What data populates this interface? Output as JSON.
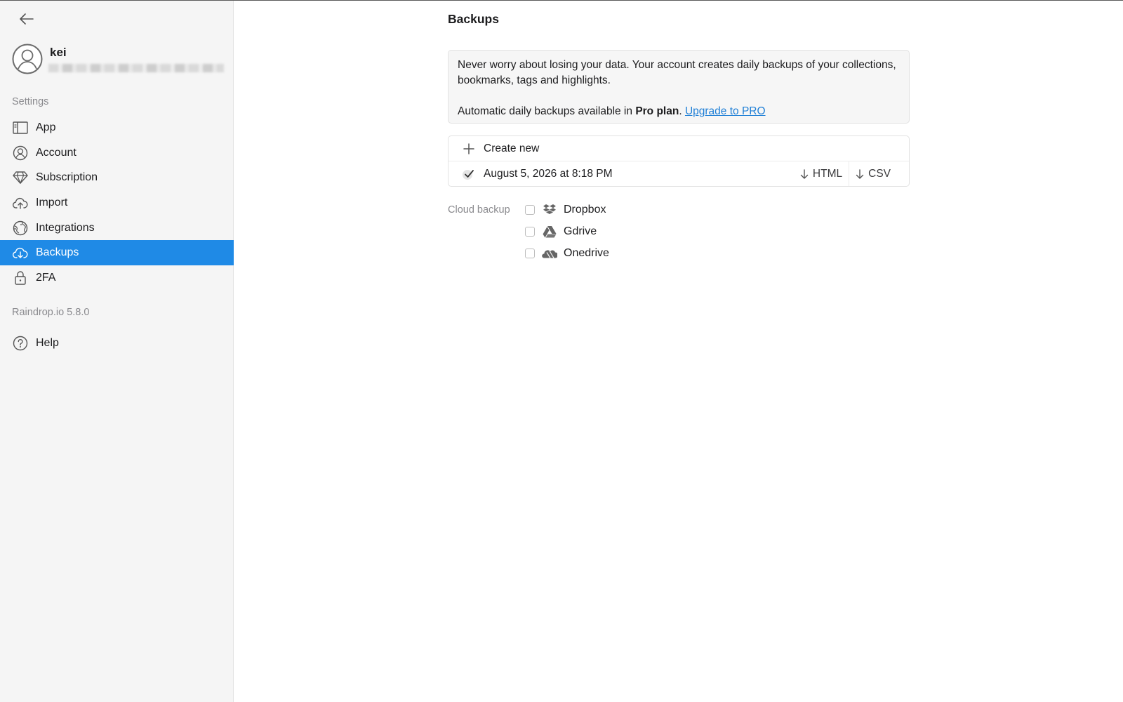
{
  "user": {
    "name": "kei"
  },
  "sidebar": {
    "section_settings": "Settings",
    "items": [
      {
        "label": "App",
        "icon": "app-window-icon"
      },
      {
        "label": "Account",
        "icon": "account-icon"
      },
      {
        "label": "Subscription",
        "icon": "diamond-icon"
      },
      {
        "label": "Import",
        "icon": "cloud-upload-icon"
      },
      {
        "label": "Integrations",
        "icon": "globe-icon"
      },
      {
        "label": "Backups",
        "icon": "cloud-download-icon",
        "active": true
      },
      {
        "label": "2FA",
        "icon": "lock-icon"
      }
    ],
    "version": "Raindrop.io 5.8.0",
    "help": "Help"
  },
  "main": {
    "title": "Backups",
    "info": {
      "line1": "Never worry about losing your data. Your account creates daily backups of your collections, bookmarks, tags and highlights.",
      "line2_prefix": "Automatic daily backups available in ",
      "line2_bold": "Pro plan",
      "line2_dot": ".",
      "upgrade_link": "Upgrade to PRO"
    },
    "create_new": "Create new",
    "backups": [
      {
        "date": "August 5, 2026 at 8:18 PM",
        "html": "HTML",
        "csv": "CSV"
      }
    ],
    "cloud_backup_label": "Cloud backup",
    "cloud": [
      {
        "label": "Dropbox",
        "checked": false
      },
      {
        "label": "Gdrive",
        "checked": false
      },
      {
        "label": "Onedrive",
        "checked": false
      }
    ]
  },
  "colors": {
    "accent": "#1f8ae6",
    "link": "#1f7fd6"
  }
}
